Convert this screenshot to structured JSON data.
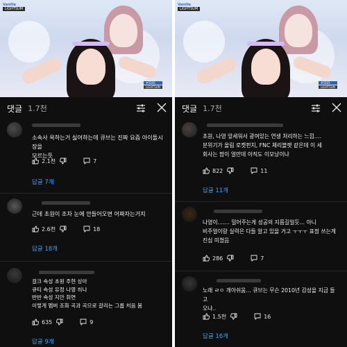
{
  "video": {
    "channel_logo": "Vanilla",
    "stage_label": "LIGHTSUM",
    "caption_top": "#5505",
    "caption_bottom": "LIGHTSUM"
  },
  "left": {
    "header": {
      "title": "댓글",
      "count": "1.7천"
    },
    "comments": [
      {
        "lines": [
          "소속사 욕하는거 싫어하는데 큐브는 진짜 요즘 아이돌시장을",
          "모르는듯"
        ],
        "likes": "2.1천",
        "replies": "7",
        "reply_link": "답글 7개"
      },
      {
        "lines": [
          "근데 초원이 조차 눈에 안들어오면 어짜자는거지"
        ],
        "likes": "2.6천",
        "replies": "18",
        "reply_link": "답글 18개"
      },
      {
        "lines": [
          "걸크 속성 초원 주현 상아",
          "큐티 속성 유정 나영 히나",
          "반반 속성 지안 휘연",
          "이렇게 멤버 조화 곡과 곡으로 갈리는 그룹 처음 봄"
        ],
        "likes": "635",
        "replies": "9",
        "reply_link": "답글 9개"
      }
    ]
  },
  "right": {
    "header": {
      "title": "댓글",
      "count": "1.7천"
    },
    "comments": [
      {
        "lines": [
          "초원, 나영 앞세워서 광여있는 연생 처리하는 느낌....",
          "분위기가 올림 로켓펀치, FNC 체리블렛 같은데 이 세",
          "회사는 팜이 얼만데 아직도 이모냥이냐"
        ],
        "likes": "822",
        "replies": "11",
        "reply_link": "답글 11개"
      },
      {
        "lines": [
          "나영이....... 밀어주는게 성공의 지름길일듯... 아니",
          "비주얼이랑 실력은 다들 알고 있을 거고 ㅜㅜㅜ 표정 쓰는게",
          "진심 미쳤음"
        ],
        "likes": "286",
        "replies": "7",
        "reply_link": ""
      },
      {
        "lines": [
          "노래 ㄹㅇ 개아쉬움... 큐브는 무슨 2010년 감성을 지금 들고",
          "오냐.."
        ],
        "likes": "1.5천",
        "replies": "16",
        "reply_link": "답글 16개"
      }
    ]
  },
  "icons": {
    "like": "thumbs-up-icon",
    "dislike": "thumbs-down-icon",
    "reply": "comment-icon",
    "sort": "sort-icon",
    "close": "close-icon"
  },
  "colors": {
    "background": "#0f0f0f",
    "text": "#f1f1f1",
    "link": "#3ea6ff",
    "muted": "#aaaaaa"
  }
}
